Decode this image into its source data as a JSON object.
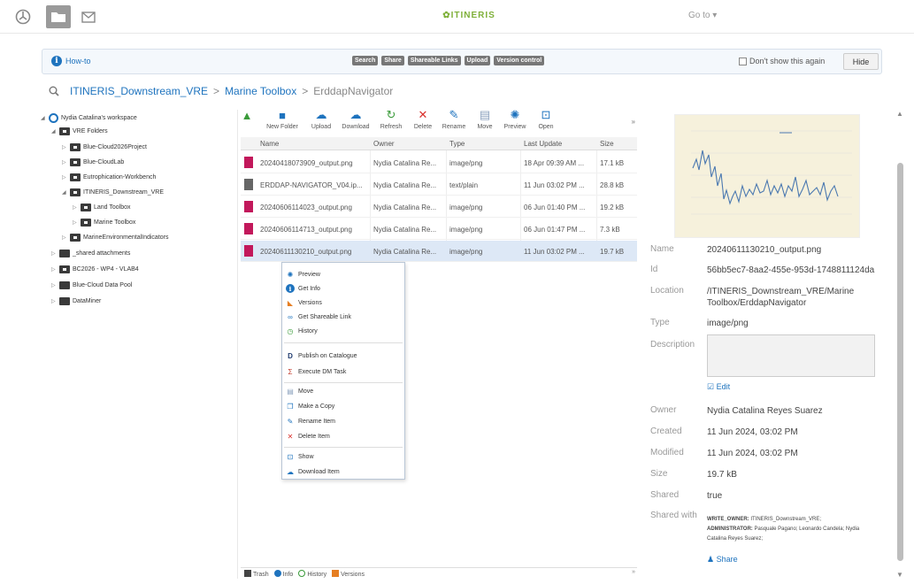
{
  "topbar": {
    "brand": "ITINERIS",
    "goto": "Go to",
    "icons": [
      "dashboard-icon",
      "folder-icon",
      "mail-icon"
    ]
  },
  "howto": {
    "label": "How-to",
    "buttons": [
      "Search",
      "Share",
      "Shareable Links",
      "Upload",
      "Version control"
    ],
    "dont_show": "Don't show this again",
    "hide": "Hide"
  },
  "breadcrumb": {
    "root": "ITINERIS_Downstream_VRE",
    "sep1": ">",
    "middle": "Marine Toolbox",
    "sep2": ">",
    "current": "ErddapNavigator"
  },
  "tree": {
    "workspace": "Nydia Catalina's workspace",
    "vre_folders": "VRE Folders",
    "items": [
      "Blue-Cloud2026Project",
      "Blue-CloudLab",
      "Eutrophication-Workbench",
      "ITINERIS_Downstream_VRE",
      "Land Toolbox",
      "Marine Toolbox",
      "MarineEnvironmentalIndicators",
      "_shared attachments",
      "BC2026 - WP4 - VLAB4",
      "Blue-Cloud Data Pool",
      "DataMiner"
    ]
  },
  "toolbar": {
    "new_folder": "New Folder",
    "upload": "Upload",
    "download": "Download",
    "refresh": "Refresh",
    "delete": "Delete",
    "rename": "Rename",
    "move": "Move",
    "preview": "Preview",
    "open": "Open",
    "more": "»"
  },
  "table": {
    "headers": {
      "name": "Name",
      "owner": "Owner",
      "type": "Type",
      "update": "Last Update",
      "size": "Size"
    },
    "rows": [
      {
        "name": "20240418073909_output.png",
        "owner": "Nydia Catalina Re...",
        "type": "image/png",
        "update": "18 Apr 09:39 AM ...",
        "size": "17.1 kB",
        "kind": "img"
      },
      {
        "name": "ERDDAP-NAVIGATOR_V04.ip...",
        "owner": "Nydia Catalina Re...",
        "type": "text/plain",
        "update": "11 Jun 03:02 PM ...",
        "size": "28.8 kB",
        "kind": "txt"
      },
      {
        "name": "20240606114023_output.png",
        "owner": "Nydia Catalina Re...",
        "type": "image/png",
        "update": "06 Jun 01:40 PM ...",
        "size": "19.2 kB",
        "kind": "img"
      },
      {
        "name": "20240606114713_output.png",
        "owner": "Nydia Catalina Re...",
        "type": "image/png",
        "update": "06 Jun 01:47 PM ...",
        "size": "7.3 kB",
        "kind": "img"
      },
      {
        "name": "20240611130210_output.png",
        "owner": "Nydia Catalina Re...",
        "type": "image/png",
        "update": "11 Jun 03:02 PM ...",
        "size": "19.7 kB",
        "kind": "img"
      }
    ]
  },
  "context_menu": {
    "items": [
      "Preview",
      "Get Info",
      "Versions",
      "Get Shareable Link",
      "History",
      "Publish on Catalogue",
      "Execute DM Task",
      "Move",
      "Make a Copy",
      "Rename Item",
      "Delete Item",
      "Show",
      "Download Item"
    ]
  },
  "statusbar": {
    "trash": "Trash",
    "info": "Info",
    "history": "History",
    "versions": "Versions",
    "more": "»"
  },
  "details": {
    "name_label": "Name",
    "name": "20240611130210_output.png",
    "id_label": "Id",
    "id": "56bb5ec7-8aa2-455e-953d-1748811124da",
    "location_label": "Location",
    "location": "/ITINERIS_Downstream_VRE/Marine Toolbox/ErddapNavigator",
    "type_label": "Type",
    "type": "image/png",
    "description_label": "Description",
    "edit": "Edit",
    "owner_label": "Owner",
    "owner": "Nydia Catalina Reyes Suarez",
    "created_label": "Created",
    "created": "11 Jun 2024, 03:02 PM",
    "modified_label": "Modified",
    "modified": "11 Jun 2024, 03:02 PM",
    "size_label": "Size",
    "size": "19.7 kB",
    "shared_label": "Shared",
    "shared": "true",
    "shared_with_label": "Shared with",
    "shared_with_write_label": "WRITE_OWNER:",
    "shared_with_write": "ITINERIS_Downstream_VRE;",
    "shared_with_admin_label": "ADMINISTRATOR:",
    "shared_with_admin": "Pasquale Pagano; Leonardo Candela; Nydia Catalina Reyes Suarez;",
    "share": "Share"
  },
  "colors": {
    "accent": "#1e73be",
    "brand": "#7fb03a",
    "selected_row": "#dde8f6",
    "image_file": "#c2185b",
    "preview_bg": "#f6f1dc",
    "plot_line": "#4a78b0"
  }
}
